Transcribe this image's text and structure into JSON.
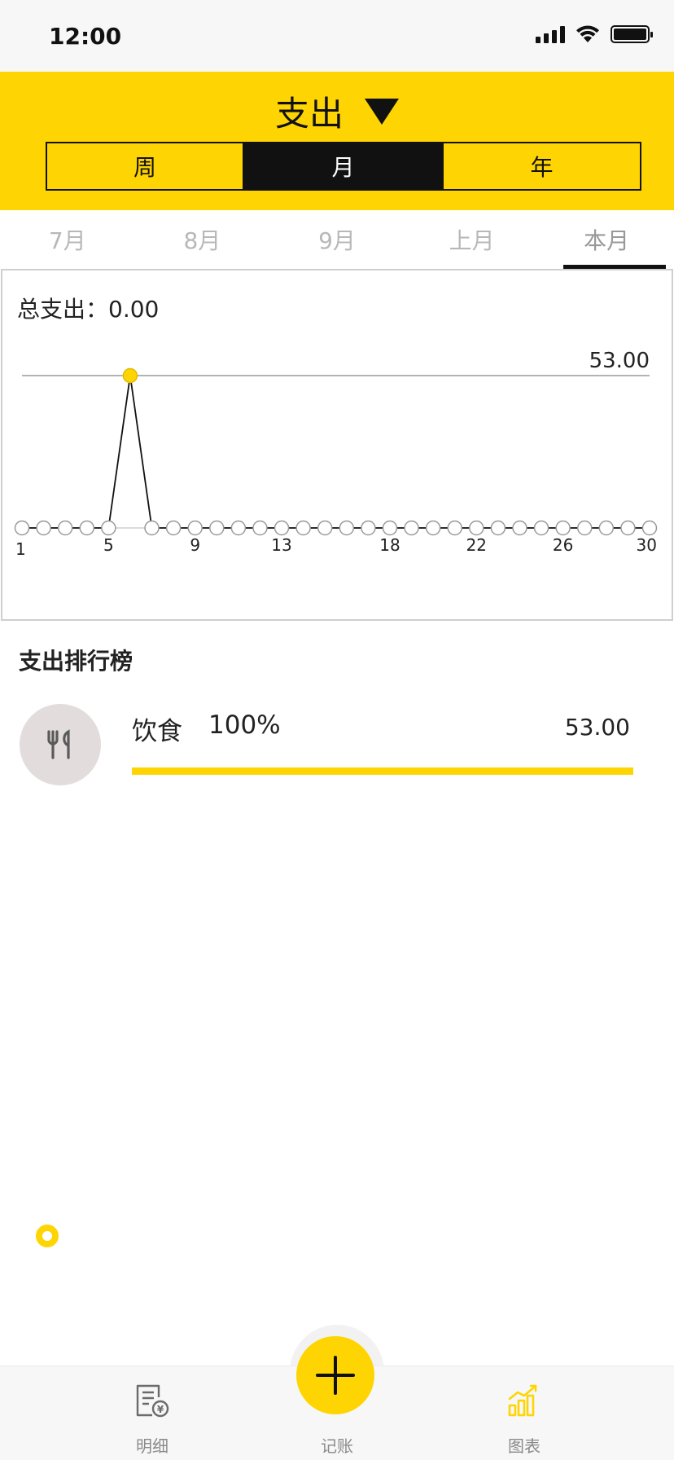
{
  "status_bar": {
    "time": "12:00"
  },
  "header": {
    "title": "支出",
    "segments": [
      "周",
      "月",
      "年"
    ],
    "selected_segment": "月"
  },
  "month_tabs": [
    "7月",
    "8月",
    "9月",
    "上月",
    "本月"
  ],
  "active_month_tab": "本月",
  "summary": {
    "label": "总支出：",
    "value": "0.00"
  },
  "chart_data": {
    "type": "line",
    "x": [
      1,
      2,
      3,
      4,
      5,
      6,
      7,
      8,
      9,
      10,
      11,
      12,
      13,
      14,
      15,
      16,
      17,
      18,
      19,
      20,
      21,
      22,
      23,
      24,
      25,
      26,
      27,
      28,
      29,
      30
    ],
    "series": [
      {
        "values": [
          0,
          0,
          0,
          0,
          0,
          53,
          0,
          0,
          0,
          0,
          0,
          0,
          0,
          0,
          0,
          0,
          0,
          0,
          0,
          0,
          0,
          0,
          0,
          0,
          0,
          0,
          0,
          0,
          0,
          0
        ]
      }
    ],
    "x_tick_labels": [
      "1",
      "5",
      "9",
      "13",
      "18",
      "22",
      "26",
      "30"
    ],
    "max_line_label": "53.00",
    "max_value": 53,
    "highlight_index": 5,
    "ylim": [
      0,
      53
    ],
    "grid": false,
    "line_color": "#111111",
    "highlight_color": "#fed502"
  },
  "ranking": {
    "title": "支出排行榜",
    "items": [
      {
        "category": "饮食",
        "percent": "100%",
        "amount": "53.00",
        "fraction": 1.0,
        "icon": "utensils-icon"
      }
    ]
  },
  "tab_bar": {
    "items": [
      {
        "label": "明细",
        "icon": "receipt-icon"
      },
      {
        "label": "记账",
        "icon": "plus-icon"
      },
      {
        "label": "图表",
        "icon": "bar-chart-icon"
      }
    ],
    "active": "图表"
  },
  "colors": {
    "accent": "#fed502",
    "dark": "#111111",
    "muted": "#b8b8b8"
  }
}
